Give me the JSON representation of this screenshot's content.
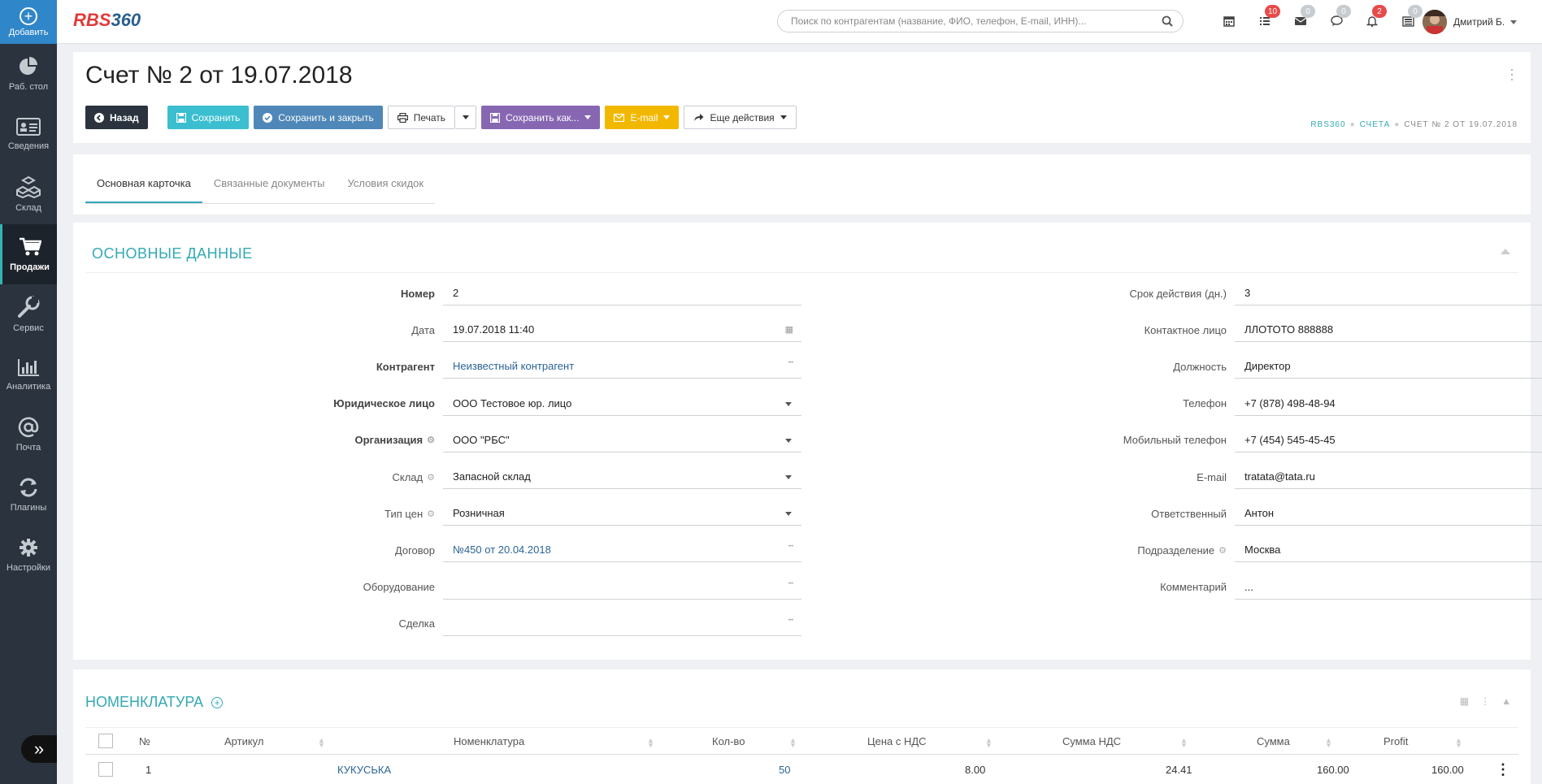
{
  "sidebar": {
    "add_label": "Добавить",
    "items": [
      {
        "label": "Раб. стол",
        "icon": "pie-chart-icon"
      },
      {
        "label": "Сведения",
        "icon": "id-card-icon"
      },
      {
        "label": "Склад",
        "icon": "boxes-icon"
      },
      {
        "label": "Продажи",
        "icon": "cart-icon",
        "active": true
      },
      {
        "label": "Сервис",
        "icon": "wrench-icon"
      },
      {
        "label": "Аналитика",
        "icon": "bar-chart-icon"
      },
      {
        "label": "Почта",
        "icon": "at-icon"
      },
      {
        "label": "Плагины",
        "icon": "refresh-icon"
      },
      {
        "label": "Настройки",
        "icon": "gear-icon"
      }
    ]
  },
  "topbar": {
    "logo_r": "RBS",
    "logo_n": "360",
    "search_placeholder": "Поиск по контрагентам (название, ФИО, телефон, E-mail, ИНН)...",
    "icons": [
      {
        "name": "calendar-icon",
        "badge": ""
      },
      {
        "name": "tasks-icon",
        "badge": "10",
        "badge_color": "#e84a4a"
      },
      {
        "name": "envelope-icon",
        "badge": "0",
        "badge_color": "#c7ccd1"
      },
      {
        "name": "chat-icon",
        "badge": "0",
        "badge_color": "#c7ccd1"
      },
      {
        "name": "bell-icon",
        "badge": "2",
        "badge_color": "#e84a4a"
      },
      {
        "name": "news-icon",
        "badge": "0",
        "badge_color": "#c7ccd1"
      }
    ],
    "user_name": "Дмитрий Б."
  },
  "header": {
    "title": "Счет № 2 от 19.07.2018",
    "buttons": {
      "back": "Назад",
      "save": "Сохранить",
      "save_close": "Сохранить и закрыть",
      "print": "Печать",
      "save_as": "Сохранить как...",
      "email": "E-mail",
      "more": "Еще действия"
    },
    "breadcrumb": [
      "RBS360",
      "Счета",
      "Счет № 2 от 19.07.2018"
    ]
  },
  "tabs": [
    "Основная карточка",
    "Связанные документы",
    "Условия скидок"
  ],
  "main": {
    "section_title": "ОСНОВНЫЕ ДАННЫЕ",
    "left_fields": [
      {
        "label": "Номер",
        "value": "2",
        "bold": true
      },
      {
        "label": "Дата",
        "value": "19.07.2018 11:40",
        "icon": "calendar-icon"
      },
      {
        "label": "Контрагент",
        "value": "Неизвестный контрагент",
        "bold": true,
        "link": true,
        "icon": "ellipsis-icon"
      },
      {
        "label": "Юридическое лицо",
        "value": "ООО Тестовое юр. лицо",
        "bold": true,
        "dropdown": true
      },
      {
        "label": "Организация",
        "value": "ООО \"РБС\"",
        "bold": true,
        "gear": true,
        "dropdown": true
      },
      {
        "label": "Склад",
        "value": "Запасной склад",
        "gear": true,
        "dropdown": true
      },
      {
        "label": "Тип цен",
        "value": "Розничная",
        "gear": true,
        "dropdown": true
      },
      {
        "label": "Договор",
        "value": "№450 от 20.04.2018",
        "link": true,
        "icon": "ellipsis-icon"
      },
      {
        "label": "Оборудование",
        "value": "",
        "icon": "ellipsis-icon"
      },
      {
        "label": "Сделка",
        "value": "",
        "icon": "ellipsis-icon"
      }
    ],
    "right_fields": [
      {
        "label": "Срок действия (дн.)",
        "value": "3"
      },
      {
        "label": "Контактное лицо",
        "value": "ЛЛОТОТО 888888",
        "dropdown": true
      },
      {
        "label": "Должность",
        "value": "Директор"
      },
      {
        "label": "Телефон",
        "value": "+7 (878) 498-48-94",
        "icon": "phone-icon"
      },
      {
        "label": "Мобильный телефон",
        "value": "+7 (454) 545-45-45",
        "icon": "phone-icon"
      },
      {
        "label": "E-mail",
        "value": "tratata@tata.ru",
        "icon": "envelope-icon"
      },
      {
        "label": "Ответственный",
        "value": "Антон",
        "dropdown": true
      },
      {
        "label": "Подразделение",
        "value": "Москва",
        "gear": true,
        "dropdown": true
      },
      {
        "label": "Комментарий",
        "value": "..."
      }
    ]
  },
  "nomenclature": {
    "title": "НОМЕНКЛАТУРА",
    "columns": [
      "№",
      "Артикул",
      "Номенклатура",
      "Кол-во",
      "Цена с НДС",
      "Сумма НДС",
      "Сумма",
      "Profit"
    ],
    "rows": [
      {
        "num": "1",
        "article": "КУКУСЬКА",
        "name": "",
        "qty": "50",
        "price": "8.00",
        "vat": "24.41",
        "sum": "160.00",
        "profit": "160.00"
      }
    ]
  }
}
